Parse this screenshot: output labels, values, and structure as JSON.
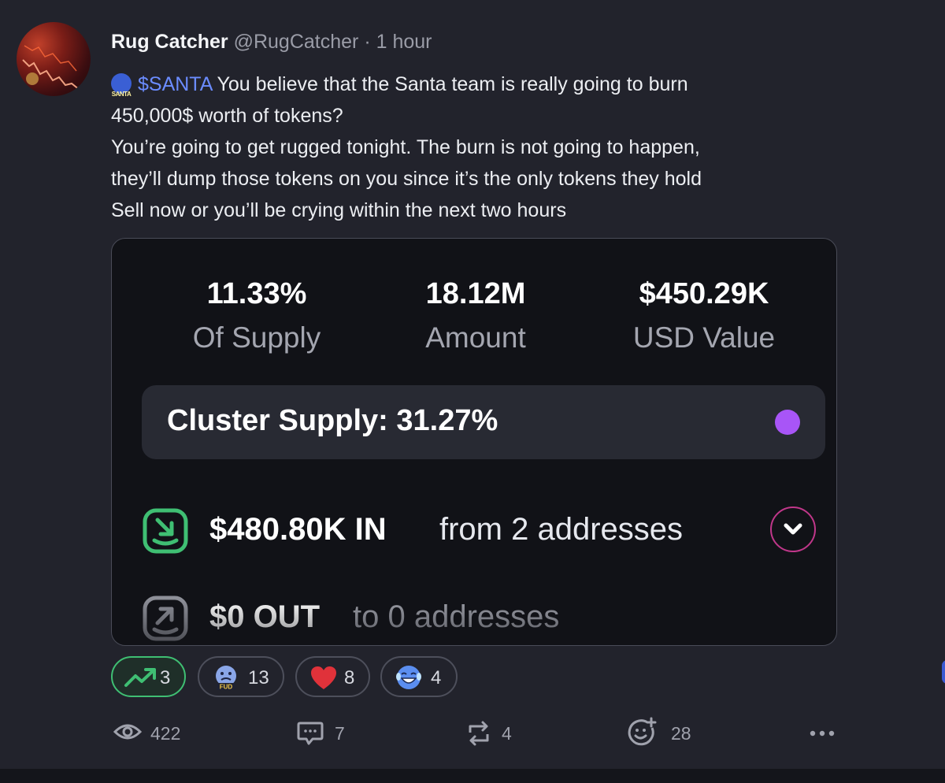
{
  "post": {
    "author_name": "Rug Catcher",
    "handle": "@RugCatcher",
    "separator": "·",
    "time": "1 hour",
    "ticker_icon_text": "SANTA",
    "cashtag": "$SANTA",
    "line1_rest": " You believe that the Santa team is really going to burn",
    "line2": "450,000$ worth of tokens?",
    "line3": "You’re going to get rugged tonight. The burn is not going to happen,",
    "line4": "they’ll dump those tokens on you since it’s the only tokens they hold",
    "line5": "Sell now or you’ll be crying within the next two hours"
  },
  "card": {
    "stats": [
      {
        "value": "11.33%",
        "label": "Of Supply"
      },
      {
        "value": "18.12M",
        "label": "Amount"
      },
      {
        "value": "$450.29K",
        "label": "USD Value"
      }
    ],
    "cluster_supply": "Cluster Supply: 31.27%",
    "cluster_dot_color": "#a855f7",
    "flow_in": {
      "amount": "$480.80K IN",
      "desc": "from 2 addresses",
      "icon": "download-in-icon",
      "color": "#3fbf73"
    },
    "flow_out": {
      "amount": "$0 OUT",
      "desc": "to 0 addresses",
      "icon": "upload-out-icon",
      "color": "#8e9099"
    }
  },
  "reactions": [
    {
      "icon": "trending-up-icon",
      "count": "3",
      "active": true
    },
    {
      "icon": "fud-face-icon",
      "count": "13",
      "active": false
    },
    {
      "icon": "heart-icon",
      "count": "8",
      "active": false
    },
    {
      "icon": "laughing-face-icon",
      "count": "4",
      "active": false
    }
  ],
  "actions": {
    "views": "422",
    "comments": "7",
    "reposts": "4",
    "likes": "28"
  },
  "colors": {
    "accent_link": "#6b8cff",
    "active_green": "#3fbf73",
    "expand_border": "#c0378a",
    "heart_red": "#e0323a"
  }
}
